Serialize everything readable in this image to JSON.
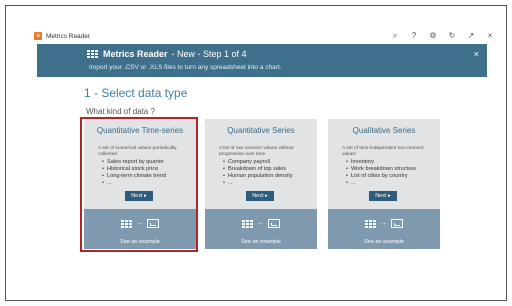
{
  "titlebar": {
    "logo": "a",
    "title": "Metrics Reader",
    "icons": [
      "search-icon",
      "help-icon",
      "settings-icon",
      "refresh-icon",
      "pin-icon",
      "close-icon"
    ],
    "icon_glyphs": [
      "⌕",
      "?",
      "⚙",
      "↻",
      "↗",
      "×"
    ]
  },
  "banner": {
    "title": "Metrics Reader",
    "step": "- New - Step 1 of 4",
    "subtitle": "Import your .CSV or .XLS files to turn any spreadsheet into a chart.",
    "close_glyph": "×"
  },
  "main": {
    "step_title": "1 - Select data type",
    "question": "What kind of data ?"
  },
  "cards": [
    {
      "title": "Quantitative Time-series",
      "desc": "A set of numerical values periodically collected",
      "items": [
        "Sales report by quarter",
        "Historical stock price",
        "Long-term climate trend",
        "..."
      ],
      "next_label": "Next ▸",
      "example_label": "See an example",
      "selected": true
    },
    {
      "title": "Quantitative Series",
      "desc": "A list of raw numeric values without progression over time",
      "items": [
        "Company payroll",
        "Breakdown of top sales",
        "Human population density",
        "..."
      ],
      "next_label": "Next ▸",
      "example_label": "See an example",
      "selected": false
    },
    {
      "title": "Qualitative Series",
      "desc": "A set of time-independent non-numeric values",
      "items": [
        "Inventory",
        "Work breakdown structure",
        "List of cities by country",
        "..."
      ],
      "next_label": "Next ▸",
      "example_label": "See an example",
      "selected": false
    }
  ],
  "colors": {
    "banner": "#3e6f8b",
    "accent": "#3e7ea8",
    "selection": "#b0242a",
    "button": "#2d5d7b",
    "card_footer": "#7f9aae"
  }
}
